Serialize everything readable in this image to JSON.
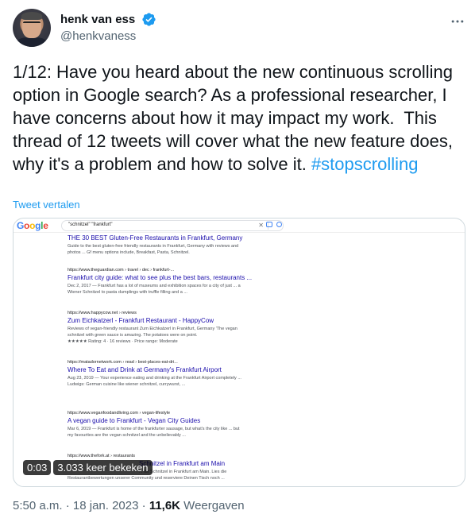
{
  "author": {
    "display_name": "henk van ess",
    "handle": "@henkvaness",
    "verified": true,
    "avatar_icon": "avatar-photo"
  },
  "tweet": {
    "text_main": "1/12: Have you heard about the new continuous scrolling option in Google search? As a professional researcher, I have concerns about how it may impact my work.  This thread of 12 tweets will cover what the new feature does, why it's a problem and how to solve it. ",
    "hashtag": "#stopscrolling",
    "translate_label": "Tweet vertalen"
  },
  "media": {
    "google": {
      "logo_text": [
        "G",
        "o",
        "o",
        "g",
        "l",
        "e"
      ],
      "query": "\"schnitzel\" \"frankfurt\"",
      "clear_icon": "close-icon",
      "camera_icon": "camera-icon",
      "search_icon": "search-icon"
    },
    "results": [
      {
        "url": "",
        "title": "THE 30 BEST Gluten-Free Restaurants in Frankfurt, Germany",
        "snippet": [
          "Guide to the best gluten-free friendly restaurants in Frankfurt, Germany with reviews and",
          "photos ... Gf menu options include, Breakfast, Pasta, Schnitzel."
        ]
      },
      {
        "url": "https://www.theguardian.com › travel › dec › frankfurt-...",
        "title": "Frankfurt city guide: what to see plus the best bars, restaurants ...",
        "snippet": [
          "Dec 2, 2017 — Frankfurt has a lot of museums and exhibition spaces for a city of just ... a",
          "Wiener Schnitzel to pasta dumplings with truffle filling and a ..."
        ]
      },
      {
        "url": "https://www.happycow.net › reviews",
        "title": "Zum Eichkatzerl - Frankfurt Restaurant - HappyCow",
        "snippet": [
          "Reviews of vegan-friendly restaurant Zum Eichkatzerl in Frankfurt, Germany 'The vegan",
          "schnitzel with green sauce is amazing. The potatoes were on point."
        ],
        "rating": "★★★★★ Rating: 4 · 16 reviews · Price range: Moderate"
      },
      {
        "url": "https://matadornetwork.com › read › best-places-eat-dri...",
        "title": "Where To Eat and Drink at Germany's Frankfurt Airport",
        "snippet": [
          "Aug 23, 2019 — Your experience eating and drinking at the Frankfurt Airport completely ...",
          "Ludwigs: German cuisine like wiener schnitzel, currywurst, ..."
        ]
      },
      {
        "url": "https://www.veganfoodandliving.com › vegan-lifestyle",
        "title": "A vegan guide to Frankfurt - Vegan City Guides",
        "snippet": [
          "Mar 6, 2019 — Frankfurt is home of the frankfurter sausage, but what's the city like ... but",
          "my favourites are the vegan schnitzel and the unbelievably ..."
        ]
      },
      {
        "url": "https://www.thefork.at › restaurants",
        "title": "Schnitzel in Frankfurt am Main",
        "snippet": [
          "... für Schnitzel in Frankfurt am Main. Lies die",
          "Restaurantbewertungen unserer Community und reserviere Deinen Tisch noch ..."
        ]
      }
    ],
    "video_time": "0:03",
    "video_views": "3.033 keer bekeken"
  },
  "meta": {
    "time": "5:50 a.m.",
    "separator1": " · ",
    "date": "18 jan. 2023",
    "separator2": " · ",
    "views_count": "11,6K",
    "views_label": " Weergaven"
  },
  "colors": {
    "link": "#1d9bf0",
    "text": "#0f1419",
    "muted": "#536471",
    "google_blue": "#1a0dab"
  }
}
